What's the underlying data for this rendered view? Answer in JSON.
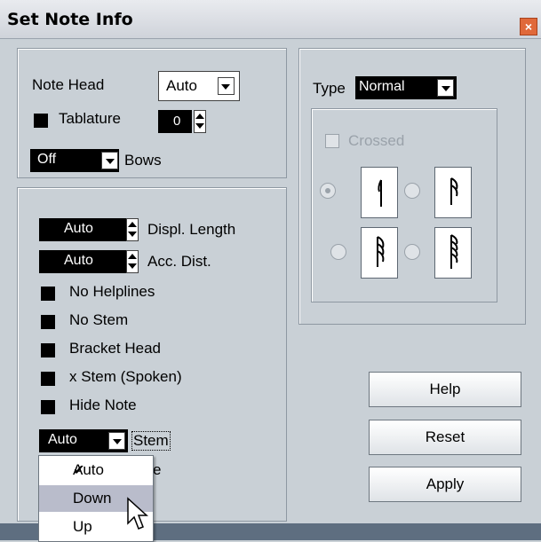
{
  "window": {
    "title": "Set Note Info",
    "close_icon": "close-icon"
  },
  "left_top": {
    "note_head_label": "Note Head",
    "note_head_value": "Auto",
    "tablature_label": "Tablature",
    "tablature_value": "0",
    "bows_value": "Off",
    "bows_label": "Bows"
  },
  "left_bottom": {
    "displ_length_value": "Auto",
    "displ_length_label": "Displ. Length",
    "acc_dist_value": "Auto",
    "acc_dist_label": "Acc. Dist.",
    "checkboxes": [
      "No Helplines",
      "No Stem",
      "Bracket Head",
      "x Stem (Spoken)",
      "Hide Note"
    ],
    "stem_value": "Auto",
    "stem_label": "Stem",
    "hidden_label_tail": "e"
  },
  "right_top": {
    "type_label": "Type",
    "type_value": "Normal",
    "crossed_label": "Crossed"
  },
  "buttons": {
    "help": "Help",
    "reset": "Reset",
    "apply": "Apply"
  },
  "stem_menu": {
    "options": [
      "Auto",
      "Down",
      "Up"
    ],
    "checked": "Auto",
    "highlighted": "Down"
  },
  "colors": {
    "highlight": "#b9bccb",
    "panel": "#c9d0d6",
    "close": "#e0693a"
  }
}
